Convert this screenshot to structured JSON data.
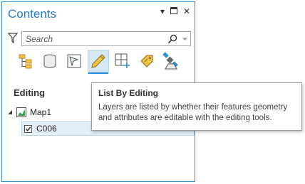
{
  "pane": {
    "title": "Contents",
    "buttons": [
      "pin-dropdown",
      "maximize",
      "close"
    ]
  },
  "search": {
    "placeholder": "Search"
  },
  "toolbar": {
    "tools": [
      {
        "name": "list-by-drawing-order",
        "icon": "drawing-order-icon"
      },
      {
        "name": "list-by-data-source",
        "icon": "data-source-icon"
      },
      {
        "name": "list-by-selection",
        "icon": "selection-icon"
      },
      {
        "name": "list-by-editing",
        "icon": "pencil-icon",
        "active": true
      },
      {
        "name": "list-by-snapping",
        "icon": "snapping-icon"
      },
      {
        "name": "list-by-labeling",
        "icon": "label-tag-icon"
      },
      {
        "name": "list-by-perspective-imagery",
        "icon": "satellite-icon"
      }
    ]
  },
  "section": {
    "heading": "Editing"
  },
  "tree": {
    "map_label": "Map1",
    "layer_label": "C006",
    "layer_checked": true
  },
  "tooltip": {
    "title": "List By Editing",
    "body": "Layers are listed by whether their features geometry and attributes are editable with the editing tools."
  },
  "colors": {
    "accent": "#2e8fd6",
    "title": "#2a79c7",
    "selection_bg": "#e4eef8"
  }
}
